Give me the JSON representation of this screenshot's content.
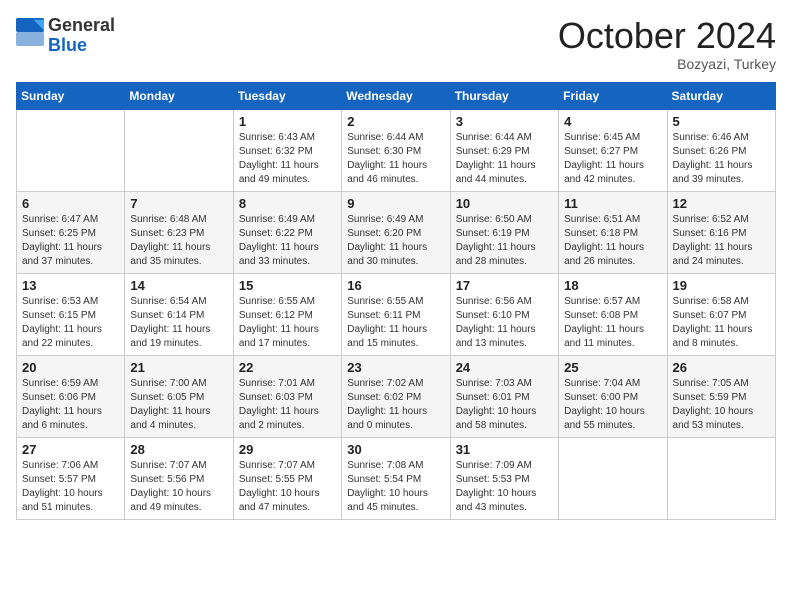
{
  "header": {
    "logo_general": "General",
    "logo_blue": "Blue",
    "month_title": "October 2024",
    "subtitle": "Bozyazi, Turkey"
  },
  "days_of_week": [
    "Sunday",
    "Monday",
    "Tuesday",
    "Wednesday",
    "Thursday",
    "Friday",
    "Saturday"
  ],
  "weeks": [
    [
      {
        "day": "",
        "sunrise": "",
        "sunset": "",
        "daylight": ""
      },
      {
        "day": "",
        "sunrise": "",
        "sunset": "",
        "daylight": ""
      },
      {
        "day": "1",
        "sunrise": "Sunrise: 6:43 AM",
        "sunset": "Sunset: 6:32 PM",
        "daylight": "Daylight: 11 hours and 49 minutes."
      },
      {
        "day": "2",
        "sunrise": "Sunrise: 6:44 AM",
        "sunset": "Sunset: 6:30 PM",
        "daylight": "Daylight: 11 hours and 46 minutes."
      },
      {
        "day": "3",
        "sunrise": "Sunrise: 6:44 AM",
        "sunset": "Sunset: 6:29 PM",
        "daylight": "Daylight: 11 hours and 44 minutes."
      },
      {
        "day": "4",
        "sunrise": "Sunrise: 6:45 AM",
        "sunset": "Sunset: 6:27 PM",
        "daylight": "Daylight: 11 hours and 42 minutes."
      },
      {
        "day": "5",
        "sunrise": "Sunrise: 6:46 AM",
        "sunset": "Sunset: 6:26 PM",
        "daylight": "Daylight: 11 hours and 39 minutes."
      }
    ],
    [
      {
        "day": "6",
        "sunrise": "Sunrise: 6:47 AM",
        "sunset": "Sunset: 6:25 PM",
        "daylight": "Daylight: 11 hours and 37 minutes."
      },
      {
        "day": "7",
        "sunrise": "Sunrise: 6:48 AM",
        "sunset": "Sunset: 6:23 PM",
        "daylight": "Daylight: 11 hours and 35 minutes."
      },
      {
        "day": "8",
        "sunrise": "Sunrise: 6:49 AM",
        "sunset": "Sunset: 6:22 PM",
        "daylight": "Daylight: 11 hours and 33 minutes."
      },
      {
        "day": "9",
        "sunrise": "Sunrise: 6:49 AM",
        "sunset": "Sunset: 6:20 PM",
        "daylight": "Daylight: 11 hours and 30 minutes."
      },
      {
        "day": "10",
        "sunrise": "Sunrise: 6:50 AM",
        "sunset": "Sunset: 6:19 PM",
        "daylight": "Daylight: 11 hours and 28 minutes."
      },
      {
        "day": "11",
        "sunrise": "Sunrise: 6:51 AM",
        "sunset": "Sunset: 6:18 PM",
        "daylight": "Daylight: 11 hours and 26 minutes."
      },
      {
        "day": "12",
        "sunrise": "Sunrise: 6:52 AM",
        "sunset": "Sunset: 6:16 PM",
        "daylight": "Daylight: 11 hours and 24 minutes."
      }
    ],
    [
      {
        "day": "13",
        "sunrise": "Sunrise: 6:53 AM",
        "sunset": "Sunset: 6:15 PM",
        "daylight": "Daylight: 11 hours and 22 minutes."
      },
      {
        "day": "14",
        "sunrise": "Sunrise: 6:54 AM",
        "sunset": "Sunset: 6:14 PM",
        "daylight": "Daylight: 11 hours and 19 minutes."
      },
      {
        "day": "15",
        "sunrise": "Sunrise: 6:55 AM",
        "sunset": "Sunset: 6:12 PM",
        "daylight": "Daylight: 11 hours and 17 minutes."
      },
      {
        "day": "16",
        "sunrise": "Sunrise: 6:55 AM",
        "sunset": "Sunset: 6:11 PM",
        "daylight": "Daylight: 11 hours and 15 minutes."
      },
      {
        "day": "17",
        "sunrise": "Sunrise: 6:56 AM",
        "sunset": "Sunset: 6:10 PM",
        "daylight": "Daylight: 11 hours and 13 minutes."
      },
      {
        "day": "18",
        "sunrise": "Sunrise: 6:57 AM",
        "sunset": "Sunset: 6:08 PM",
        "daylight": "Daylight: 11 hours and 11 minutes."
      },
      {
        "day": "19",
        "sunrise": "Sunrise: 6:58 AM",
        "sunset": "Sunset: 6:07 PM",
        "daylight": "Daylight: 11 hours and 8 minutes."
      }
    ],
    [
      {
        "day": "20",
        "sunrise": "Sunrise: 6:59 AM",
        "sunset": "Sunset: 6:06 PM",
        "daylight": "Daylight: 11 hours and 6 minutes."
      },
      {
        "day": "21",
        "sunrise": "Sunrise: 7:00 AM",
        "sunset": "Sunset: 6:05 PM",
        "daylight": "Daylight: 11 hours and 4 minutes."
      },
      {
        "day": "22",
        "sunrise": "Sunrise: 7:01 AM",
        "sunset": "Sunset: 6:03 PM",
        "daylight": "Daylight: 11 hours and 2 minutes."
      },
      {
        "day": "23",
        "sunrise": "Sunrise: 7:02 AM",
        "sunset": "Sunset: 6:02 PM",
        "daylight": "Daylight: 11 hours and 0 minutes."
      },
      {
        "day": "24",
        "sunrise": "Sunrise: 7:03 AM",
        "sunset": "Sunset: 6:01 PM",
        "daylight": "Daylight: 10 hours and 58 minutes."
      },
      {
        "day": "25",
        "sunrise": "Sunrise: 7:04 AM",
        "sunset": "Sunset: 6:00 PM",
        "daylight": "Daylight: 10 hours and 55 minutes."
      },
      {
        "day": "26",
        "sunrise": "Sunrise: 7:05 AM",
        "sunset": "Sunset: 5:59 PM",
        "daylight": "Daylight: 10 hours and 53 minutes."
      }
    ],
    [
      {
        "day": "27",
        "sunrise": "Sunrise: 7:06 AM",
        "sunset": "Sunset: 5:57 PM",
        "daylight": "Daylight: 10 hours and 51 minutes."
      },
      {
        "day": "28",
        "sunrise": "Sunrise: 7:07 AM",
        "sunset": "Sunset: 5:56 PM",
        "daylight": "Daylight: 10 hours and 49 minutes."
      },
      {
        "day": "29",
        "sunrise": "Sunrise: 7:07 AM",
        "sunset": "Sunset: 5:55 PM",
        "daylight": "Daylight: 10 hours and 47 minutes."
      },
      {
        "day": "30",
        "sunrise": "Sunrise: 7:08 AM",
        "sunset": "Sunset: 5:54 PM",
        "daylight": "Daylight: 10 hours and 45 minutes."
      },
      {
        "day": "31",
        "sunrise": "Sunrise: 7:09 AM",
        "sunset": "Sunset: 5:53 PM",
        "daylight": "Daylight: 10 hours and 43 minutes."
      },
      {
        "day": "",
        "sunrise": "",
        "sunset": "",
        "daylight": ""
      },
      {
        "day": "",
        "sunrise": "",
        "sunset": "",
        "daylight": ""
      }
    ]
  ]
}
